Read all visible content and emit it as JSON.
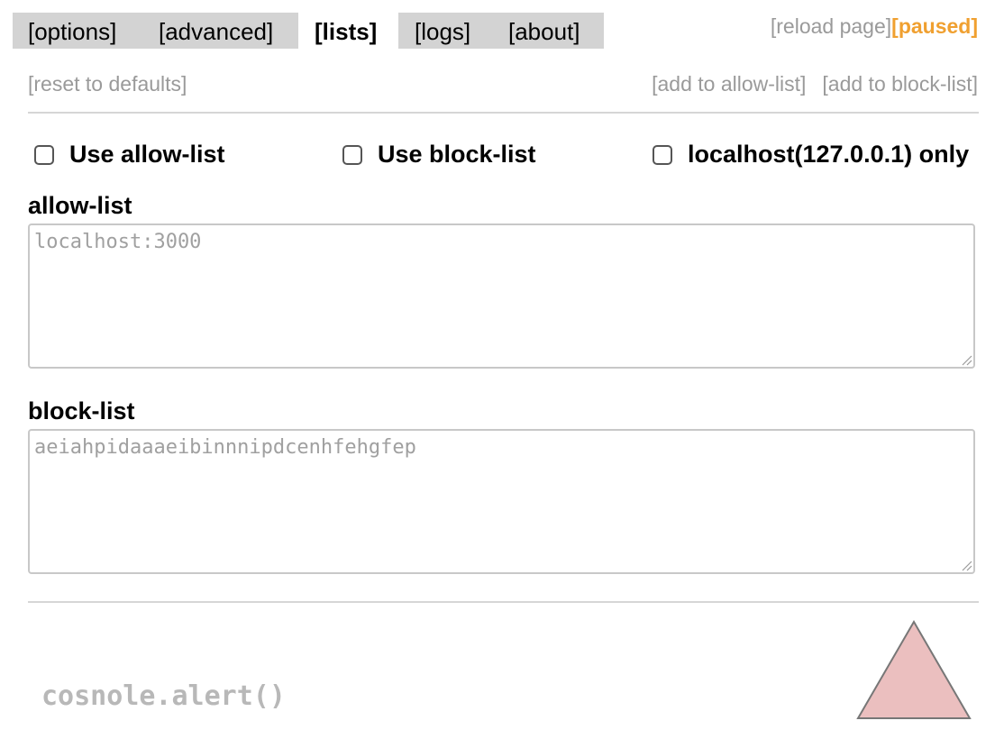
{
  "tabs": [
    {
      "label": "[options]",
      "active": false
    },
    {
      "label": "[advanced]",
      "active": false
    },
    {
      "label": "[lists]",
      "active": true
    },
    {
      "label": "[logs]",
      "active": false
    },
    {
      "label": "[about]",
      "active": false
    }
  ],
  "header": {
    "reload_label": "[reload page]",
    "status_label": "[paused]",
    "status_color": "#f0a030"
  },
  "actions": {
    "reset_label": "[reset to defaults]",
    "add_allow_label": "[add to allow-list]",
    "add_block_label": "[add to block-list]"
  },
  "options": {
    "use_allow_list": {
      "label": "Use allow-list",
      "checked": false
    },
    "use_block_list": {
      "label": "Use block-list",
      "checked": false
    },
    "localhost_only": {
      "label": "localhost(127.0.0.1) only",
      "checked": false
    }
  },
  "allow_list": {
    "label": "allow-list",
    "value": "",
    "placeholder": "localhost:3000"
  },
  "block_list": {
    "label": "block-list",
    "value": "",
    "placeholder": "aeiahpidaaaeibinnnipdcenhfehgfep"
  },
  "footer": {
    "console_text": "cosnole.alert()",
    "warning_icon": "warning-triangle-icon",
    "warning_color": "#ebbfbf"
  }
}
